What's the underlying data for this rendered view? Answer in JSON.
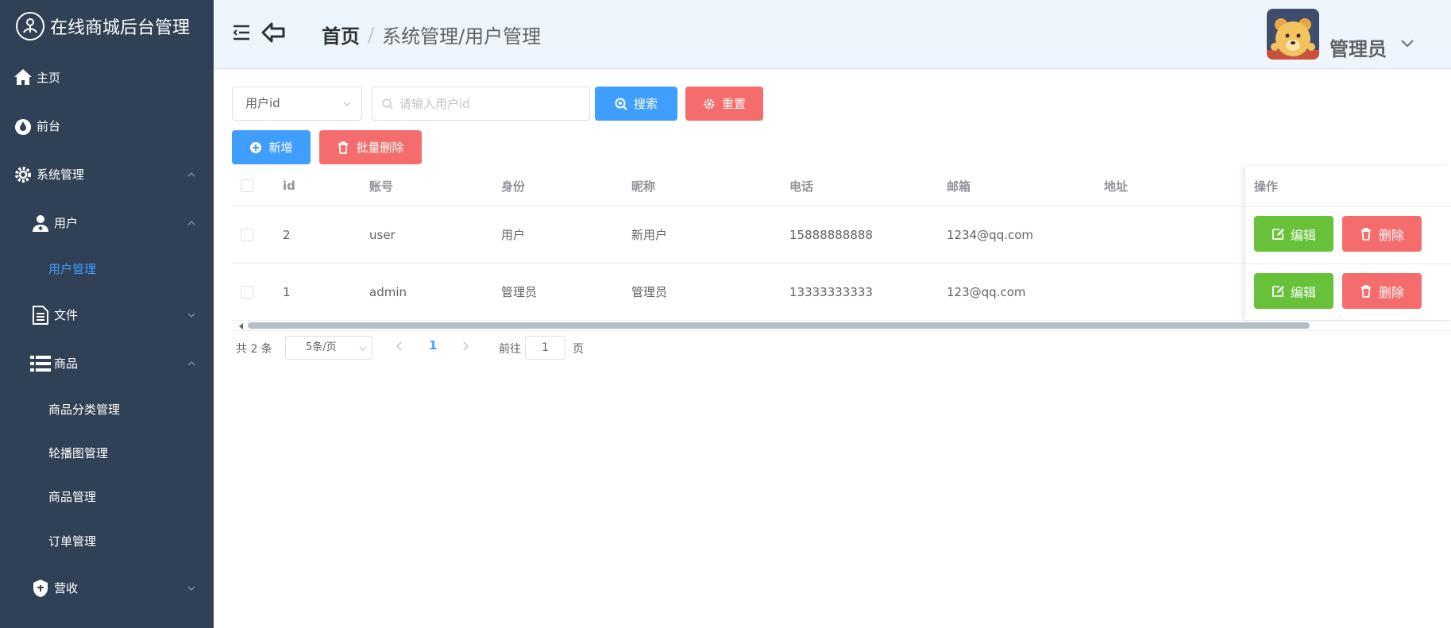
{
  "app": {
    "title": "在线商城后台管理"
  },
  "sidebar": {
    "items": [
      {
        "label": "主页",
        "icon": "home-icon"
      },
      {
        "label": "前台",
        "icon": "drop-icon"
      },
      {
        "label": "系统管理",
        "icon": "gear-icon"
      },
      {
        "label": "用户",
        "icon": "user-plus-icon"
      },
      {
        "label": "用户管理",
        "active": true
      },
      {
        "label": "文件",
        "icon": "document-icon"
      },
      {
        "label": "商品",
        "icon": "list-icon"
      },
      {
        "label": "商品分类管理"
      },
      {
        "label": "轮播图管理"
      },
      {
        "label": "商品管理"
      },
      {
        "label": "订单管理"
      },
      {
        "label": "营收",
        "icon": "badge-icon"
      }
    ]
  },
  "header": {
    "breadcrumb_home": "首页",
    "breadcrumb_sep": "/",
    "breadcrumb_current": "系统管理/用户管理",
    "username": "管理员"
  },
  "search": {
    "field_select": "用户id",
    "placeholder": "请输入用户id",
    "search_label": "搜索",
    "reset_label": "重置",
    "add_label": "新增",
    "batch_delete_label": "批量删除"
  },
  "table": {
    "headers": {
      "id": "id",
      "account": "账号",
      "role": "身份",
      "nickname": "昵称",
      "phone": "电话",
      "email": "邮箱",
      "address": "地址",
      "ops": "操作"
    },
    "rows": [
      {
        "id": "2",
        "account": "user",
        "role": "用户",
        "nickname": "新用户",
        "phone": "15888888888",
        "email": "1234@qq.com",
        "address": ""
      },
      {
        "id": "1",
        "account": "admin",
        "role": "管理员",
        "nickname": "管理员",
        "phone": "13333333333",
        "email": "123@qq.com",
        "address": ""
      }
    ],
    "edit_label": "编辑",
    "delete_label": "删除"
  },
  "pagination": {
    "total": "共 2 条",
    "page_size": "5条/页",
    "current_page": "1",
    "goto_label": "前往",
    "goto_value": "1",
    "page_suffix": "页"
  },
  "colors": {
    "sidebar": "#304156",
    "primary": "#409eff",
    "danger": "#f56c6c",
    "success": "#67c23a",
    "header": "#eef5fc"
  }
}
